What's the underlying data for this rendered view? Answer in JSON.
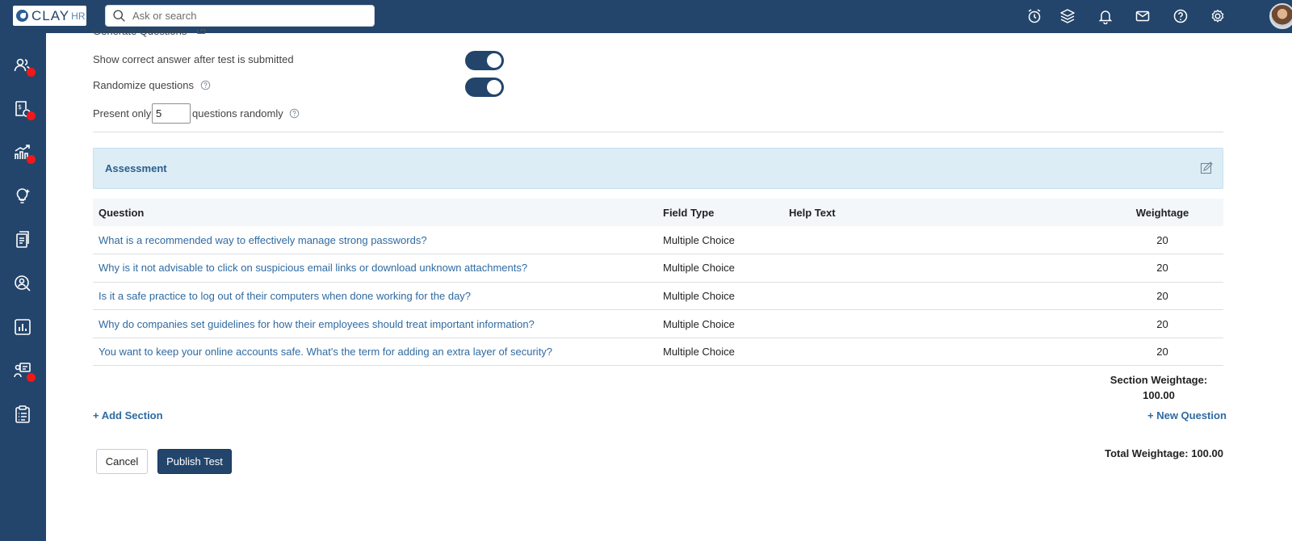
{
  "brand": {
    "logo_text": "CLAY",
    "logo_suffix": "HR"
  },
  "search": {
    "placeholder": "Ask or search"
  },
  "settings": {
    "generate_questions_label": "Generate Questions",
    "show_correct_answer_label": "Show correct answer after test is submitted",
    "show_correct_answer_on": true,
    "randomize_label": "Randomize questions",
    "randomize_on": true,
    "present_only_prefix": "Present only",
    "present_only_value": "5",
    "present_only_suffix": "questions randomly"
  },
  "section": {
    "title": "Assessment"
  },
  "table": {
    "headers": {
      "question": "Question",
      "field_type": "Field Type",
      "help_text": "Help Text",
      "weightage": "Weightage"
    },
    "rows": [
      {
        "question": "What is a recommended way to effectively manage strong passwords?",
        "field_type": "Multiple Choice",
        "help_text": "",
        "weightage": "20"
      },
      {
        "question": "Why is it not advisable to click on suspicious email links or download unknown attachments?",
        "field_type": "Multiple Choice",
        "help_text": "",
        "weightage": "20"
      },
      {
        "question": "Is it a safe practice to log out of their computers when done working for the day?",
        "field_type": "Multiple Choice",
        "help_text": "",
        "weightage": "20"
      },
      {
        "question": "Why do companies set guidelines for how their employees should treat important information?",
        "field_type": "Multiple Choice",
        "help_text": "",
        "weightage": "20"
      },
      {
        "question": "You want to keep your online accounts safe. What's the term for adding an extra layer of security?",
        "field_type": "Multiple Choice",
        "help_text": "",
        "weightage": "20"
      }
    ]
  },
  "section_weightage": {
    "label": "Section Weightage:",
    "value": "100.00"
  },
  "actions": {
    "add_section": "+ Add Section",
    "new_question": "+ New Question",
    "cancel": "Cancel",
    "publish": "Publish Test",
    "total_weightage": "Total Weightage: 100.00"
  },
  "colors": {
    "nav": "#23456b",
    "accent_link": "#2f6aa1",
    "section_bg": "#dcedf6",
    "badge": "#f01818"
  },
  "icons": {
    "topbar": [
      "alarm-clock-icon",
      "layers-icon",
      "bell-icon",
      "mail-icon",
      "help-circle-icon",
      "gear-icon"
    ],
    "sidebar": [
      "people-icon",
      "payroll-icon",
      "growth-chart-icon",
      "lightbulb-icon",
      "documents-icon",
      "user-search-icon",
      "bar-chart-icon",
      "learning-icon",
      "clipboard-icon"
    ]
  }
}
